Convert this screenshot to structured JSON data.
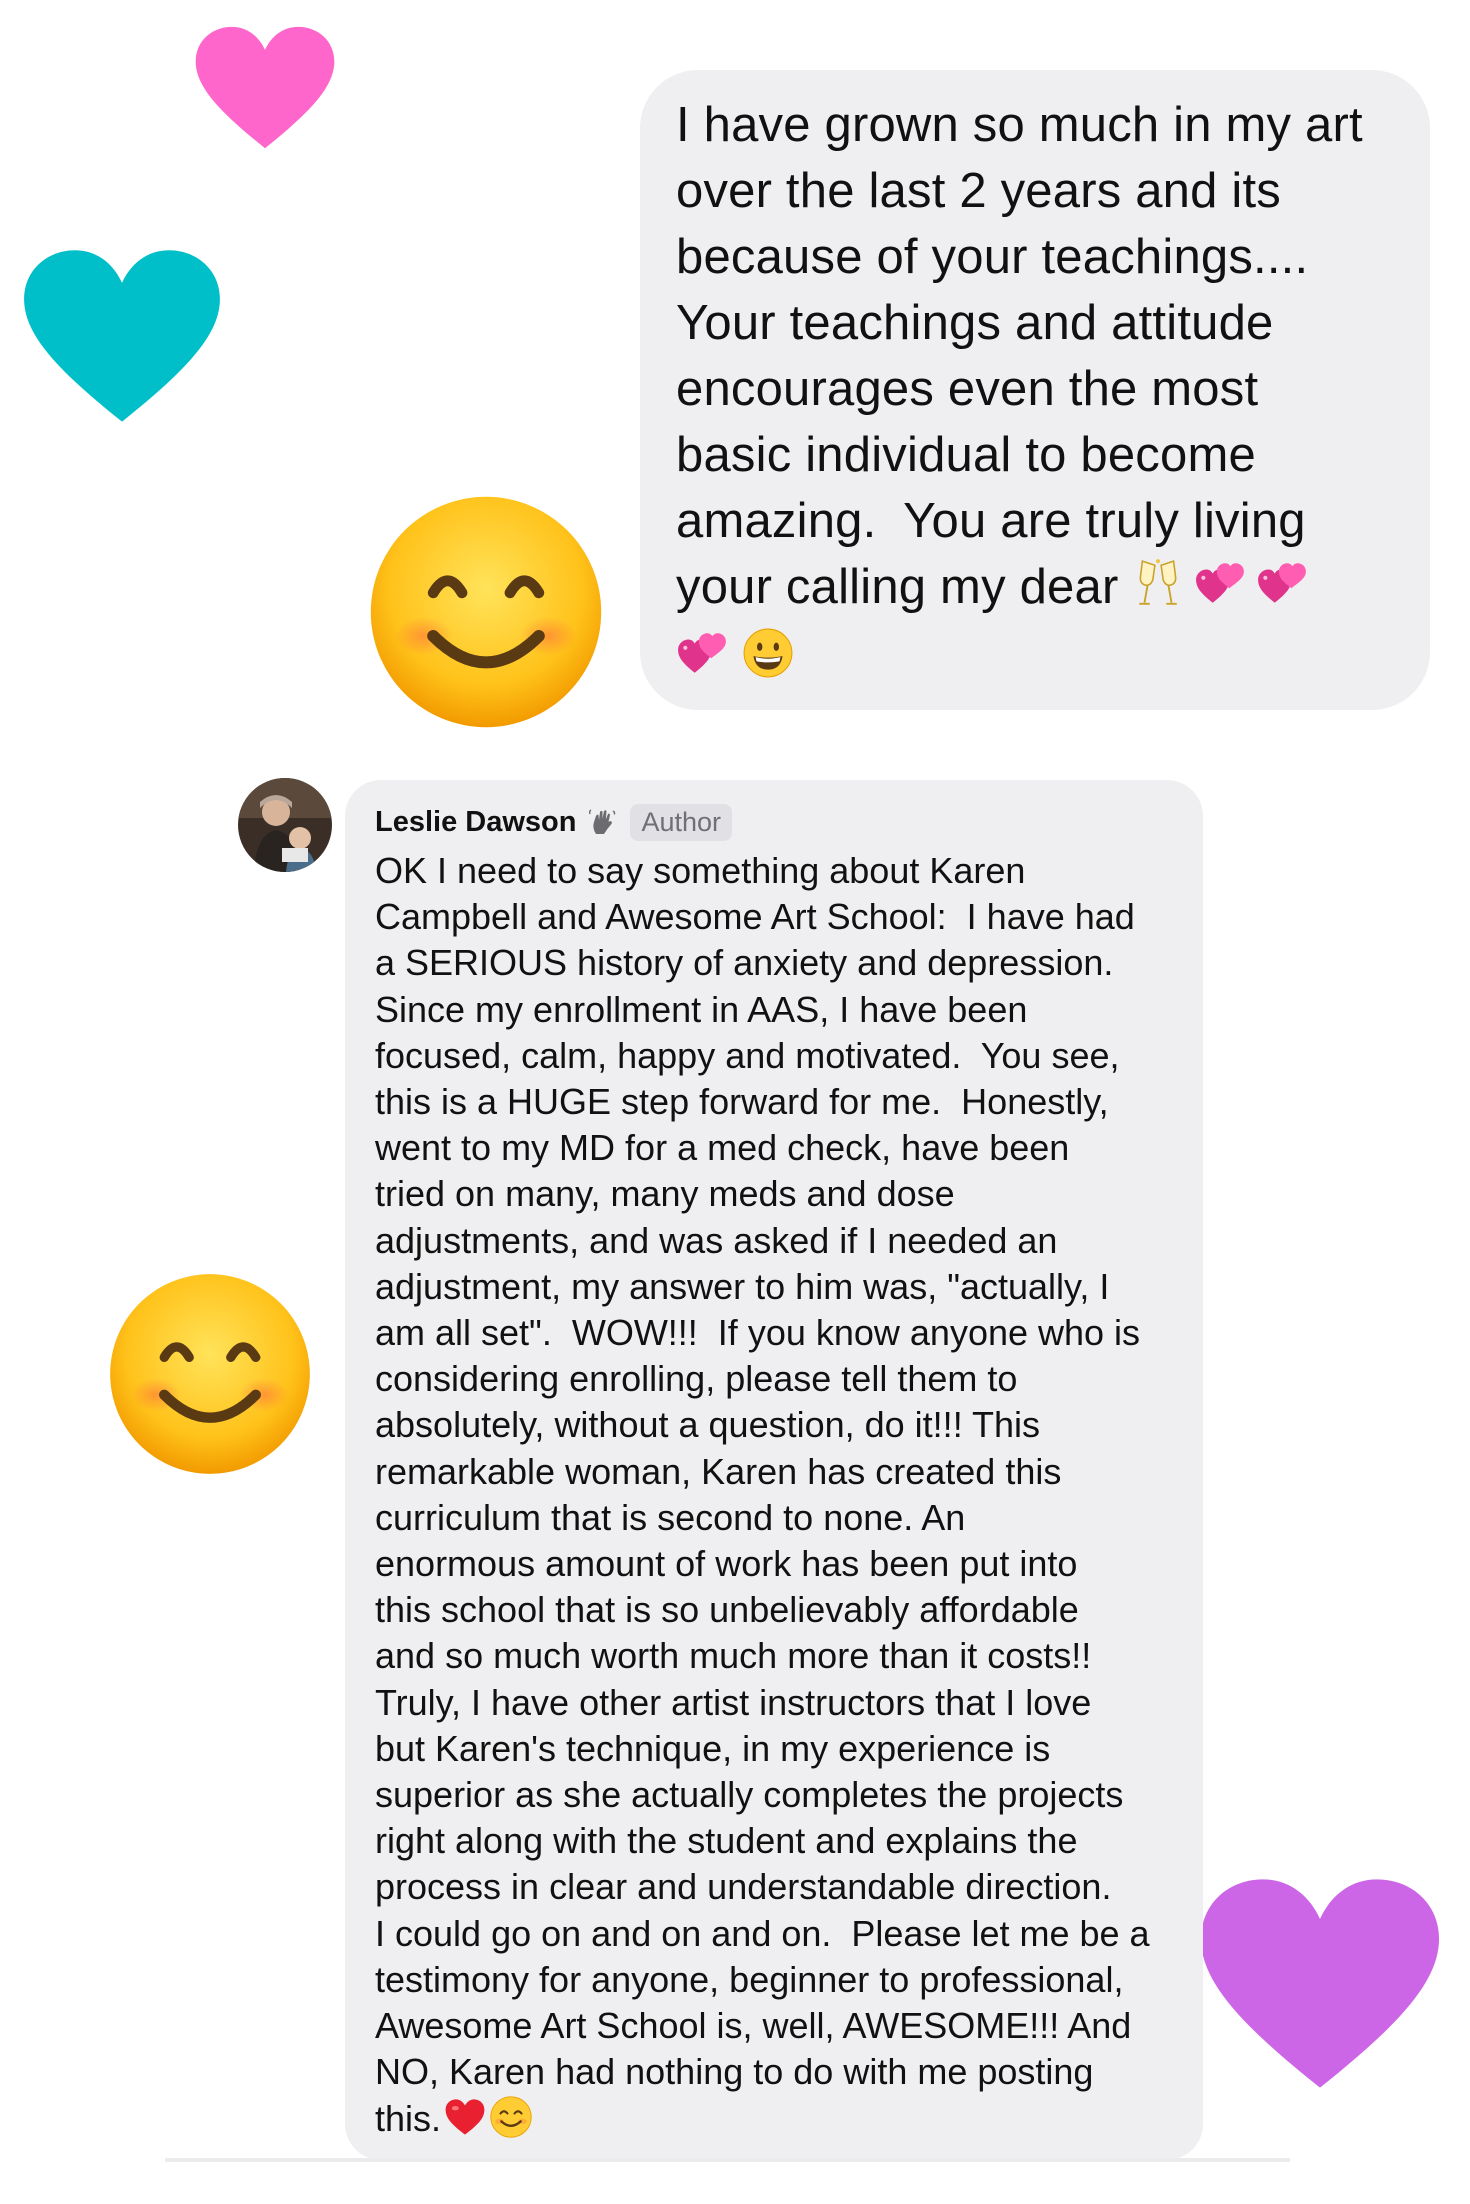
{
  "post_message": {
    "text": "I have grown so much in my art\nover the last 2 years and its\nbecause of your teachings....\nYour teachings and attitude\nencourages even the most\nbasic individual to become\namazing.  You are truly living\nyour calling my dear",
    "emojis": [
      "champagne-icon",
      "two-hearts-icon",
      "two-hearts-icon",
      "two-hearts-icon",
      "grinning-face-icon"
    ]
  },
  "comment": {
    "author_name": "Leslie Dawson",
    "author_badge_icon": "waving-hand-icon",
    "author_tag": "Author",
    "text": "OK I need to say something about Karen\nCampbell and Awesome Art School:  I have had\na SERIOUS history of anxiety and depression.\nSince my enrollment in AAS, I have been\nfocused, calm, happy and motivated.  You see,\nthis is a HUGE step forward for me.  Honestly,\nwent to my MD for a med check, have been\ntried on many, many meds and dose\nadjustments, and was asked if I needed an\nadjustment, my answer to him was, \"actually, I\nam all set\".  WOW!!!  If you know anyone who is\nconsidering enrolling, please tell them to\nabsolutely, without a question, do it!!! This\nremarkable woman, Karen has created this\ncurriculum that is second to none. An\nenormous amount of work has been put into\nthis school that is so unbelievably affordable\nand so much worth much more than it costs!!\nTruly, I have other artist instructors that I love\nbut Karen's technique, in my experience is\nsuperior as she actually completes the projects\nright along with the student and explains the\nprocess in clear and understandable direction.\nI could go on and on and on.  Please let me be a\ntestimony for anyone, beginner to professional,\nAwesome Art School is, well, AWESOME!!! And\nNO, Karen had nothing to do with me posting",
    "last_line": "this.",
    "tail_emojis": [
      "red-heart-icon",
      "smiling-face-icon"
    ]
  },
  "decorations": {
    "heart_colors": {
      "pink": "#ff66cc",
      "teal": "#00bfc9",
      "purple": "#cc66e6"
    },
    "bubble_color": "#efeff1"
  }
}
